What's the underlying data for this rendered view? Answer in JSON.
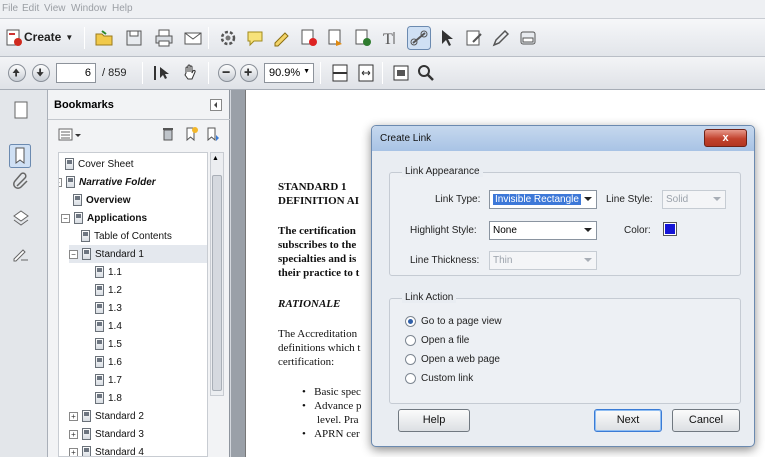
{
  "menubar": {
    "items": [
      "File",
      "Edit",
      "View",
      "Window",
      "Help"
    ]
  },
  "toolbar": {
    "create_label": "Create",
    "page_number": "6",
    "page_total": "/ 859",
    "zoom": "90.9%"
  },
  "bookmarks": {
    "title": "Bookmarks",
    "items": [
      {
        "label": "Cover Sheet"
      },
      {
        "label": "Narrative Folder"
      },
      {
        "label": "Overview"
      },
      {
        "label": "Applications"
      },
      {
        "label": "Table of Contents"
      },
      {
        "label": "Standard 1"
      },
      {
        "label": "1.1"
      },
      {
        "label": "1.2"
      },
      {
        "label": "1.3"
      },
      {
        "label": "1.4"
      },
      {
        "label": "1.5"
      },
      {
        "label": "1.6"
      },
      {
        "label": "1.7"
      },
      {
        "label": "1.8"
      },
      {
        "label": "Standard 2"
      },
      {
        "label": "Standard 3"
      },
      {
        "label": "Standard 4"
      }
    ]
  },
  "document": {
    "heading1": "STANDARD 1",
    "heading2": "DEFINITION AI",
    "para1": [
      "The certification",
      "subscribes to the",
      "specialties and is",
      "their practice to t"
    ],
    "rationale": "RATIONALE",
    "para2": [
      "The Accreditation",
      "definitions which t",
      "certification:"
    ],
    "bullets": [
      "Basic spec",
      "Advance p",
      "level.  Pra",
      "APRN cer"
    ]
  },
  "dialog": {
    "title": "Create Link",
    "close_glyph": "x",
    "appearance_group": "Link Appearance",
    "link_type_label": "Link Type:",
    "link_type_value": "Invisible Rectangle",
    "line_style_label": "Line Style:",
    "line_style_value": "Solid",
    "highlight_label": "Highlight Style:",
    "highlight_value": "None",
    "color_label": "Color:",
    "color_value": "#1515d6",
    "thickness_label": "Line Thickness:",
    "thickness_value": "Thin",
    "action_group": "Link Action",
    "actions": [
      "Go to a page view",
      "Open a file",
      "Open a web page",
      "Custom link"
    ],
    "help_label": "Help",
    "next_label": "Next",
    "cancel_label": "Cancel"
  }
}
